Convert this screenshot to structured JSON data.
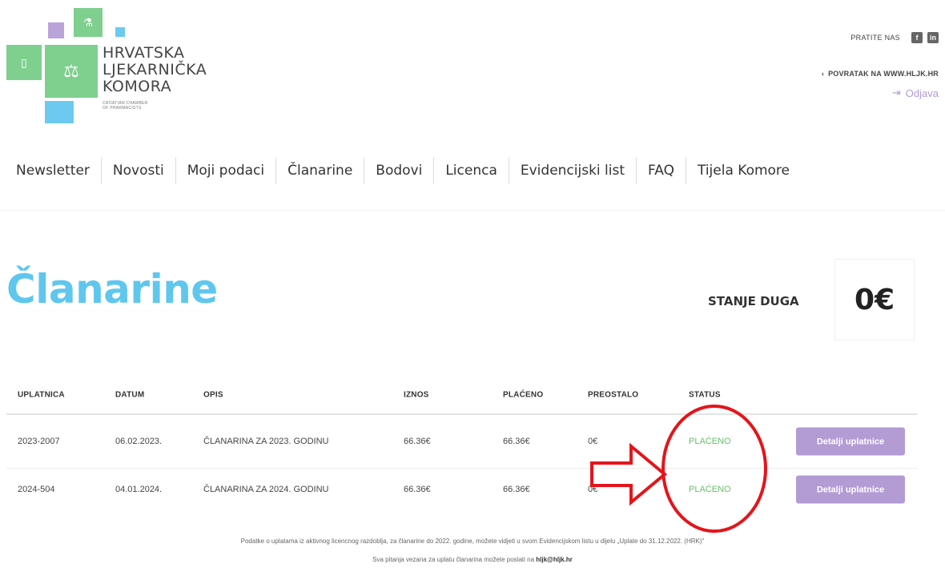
{
  "logo": {
    "line1": "HRVATSKA",
    "line2": "LJEKARNIČKA",
    "line3": "KOMORA",
    "sub1": "CROATIAN CHAMBER",
    "sub2": "OF PHARMACISTS",
    "colors": {
      "green": "#7fcf8f",
      "purple": "#b9a3d8",
      "blue": "#6ccaf0"
    }
  },
  "header": {
    "follow_label": "PRATITE NAS",
    "facebook_icon": "f",
    "linkedin_icon": "in",
    "back_chevron": "‹",
    "back_link": "POVRATAK NA WWW.HLJK.HR",
    "logout_icon": "⇥",
    "logout": "Odjava"
  },
  "nav": {
    "items": [
      "Newsletter",
      "Novosti",
      "Moji podaci",
      "Članarine",
      "Bodovi",
      "Licenca",
      "Evidencijski list",
      "FAQ",
      "Tijela Komore"
    ]
  },
  "page": {
    "title": "Članarine",
    "debt_label": "STANJE DUGA",
    "debt_value": "0€",
    "title_color": "#5fc7ee"
  },
  "table": {
    "headers": {
      "uplatnica": "UPLATNICA",
      "datum": "DATUM",
      "opis": "OPIS",
      "iznos": "IZNOS",
      "placeno": "PLAĆENO",
      "preostalo": "PREOSTALO",
      "status": "STATUS"
    },
    "rows": [
      {
        "uplatnica": "2023-2007",
        "datum": "06.02.2023.",
        "opis": "ČLANARINA ZA 2023. GODINU",
        "iznos": "66.36€",
        "placeno": "66.36€",
        "preostalo": "0€",
        "status": "PLAĆENO",
        "action": "Detalji uplatnice"
      },
      {
        "uplatnica": "2024-504",
        "datum": "04.01.2024.",
        "opis": "ČLANARINA ZA 2024. GODINU",
        "iznos": "66.36€",
        "placeno": "66.36€",
        "preostalo": "0€",
        "status": "PLAĆENO",
        "action": "Detalji uplatnice"
      }
    ]
  },
  "footer": {
    "line1": "Podatke o uplatama iz aktivnog licencnog razdoblja, za članarine do 2022. godine, možete vidjeti u svom Evidencijskom listu u dijelu „Uplate do 31.12.2022. (HRK)\"",
    "line2_prefix": "Sva pitanja vezana za uplatu članarina možete poslati na ",
    "line2_email": "hljk@hljk.hr"
  },
  "annotation": {
    "color": "#e3151b"
  }
}
